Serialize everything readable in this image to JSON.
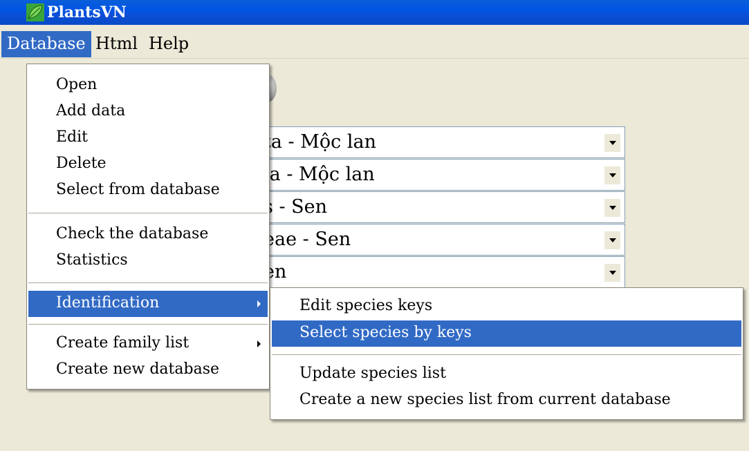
{
  "window": {
    "title": "PlantsVN",
    "icon": "leaf-icon"
  },
  "menubar": {
    "items": [
      "Database",
      "Html",
      "Help"
    ]
  },
  "combos": [
    {
      "value": "ta - Mộc lan"
    },
    {
      "value": "la - Mộc lan"
    },
    {
      "value": "s - Sen"
    },
    {
      "value": "eae - Sen"
    },
    {
      "value": "en"
    }
  ],
  "database_menu": {
    "open": "Open",
    "add_data": "Add data",
    "edit": "Edit",
    "delete": "Delete",
    "select_from_db": "Select from database",
    "check_db": "Check the database",
    "statistics": "Statistics",
    "identification": "Identification",
    "create_family_list": "Create family list",
    "create_new_db": "Create new database"
  },
  "identification_menu": {
    "edit_keys": "Edit species keys",
    "select_by_keys": "Select species by keys",
    "update_list": "Update species list",
    "create_list": "Create a new species list from current database"
  },
  "colors": {
    "highlight": "#316ac5",
    "titlebar": "#0054e3",
    "face": "#ece9d8"
  }
}
